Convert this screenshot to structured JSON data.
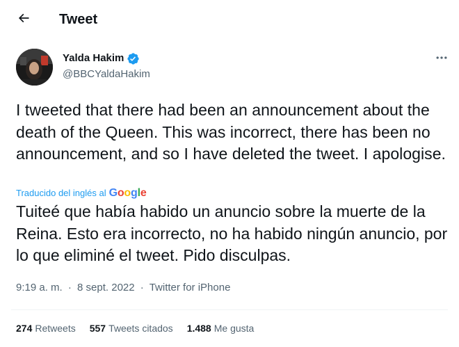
{
  "header": {
    "title": "Tweet",
    "back_icon": "arrow-left-icon"
  },
  "author": {
    "display_name": "Yalda Hakim",
    "handle": "@BBCYaldaHakim",
    "verified": true,
    "verified_color": "#1d9bf0"
  },
  "tweet": {
    "text": "I tweeted that there had been an announcement about the death of the Queen. This was incorrect, there has been no announcement, and so I have deleted the tweet. I apologise.",
    "translated_label": "Traducido del inglés al",
    "translation_provider": "Google",
    "translation": "Tuiteé que había habido un anuncio sobre la muerte de la Reina. Esto era incorrecto, no ha habido ningún anuncio, por lo que eliminé el tweet. Pido disculpas.",
    "time": "9:19 a. m.",
    "separator": "·",
    "date": "8 sept. 2022",
    "source": "Twitter for iPhone"
  },
  "stats": {
    "retweets_count": "274",
    "retweets_label": "Retweets",
    "quotes_count": "557",
    "quotes_label": "Tweets citados",
    "likes_count": "1.488",
    "likes_label": "Me gusta"
  },
  "colors": {
    "text_primary": "#0f1419",
    "text_secondary": "#536471",
    "accent": "#1d9bf0",
    "divider": "#eff3f4"
  }
}
